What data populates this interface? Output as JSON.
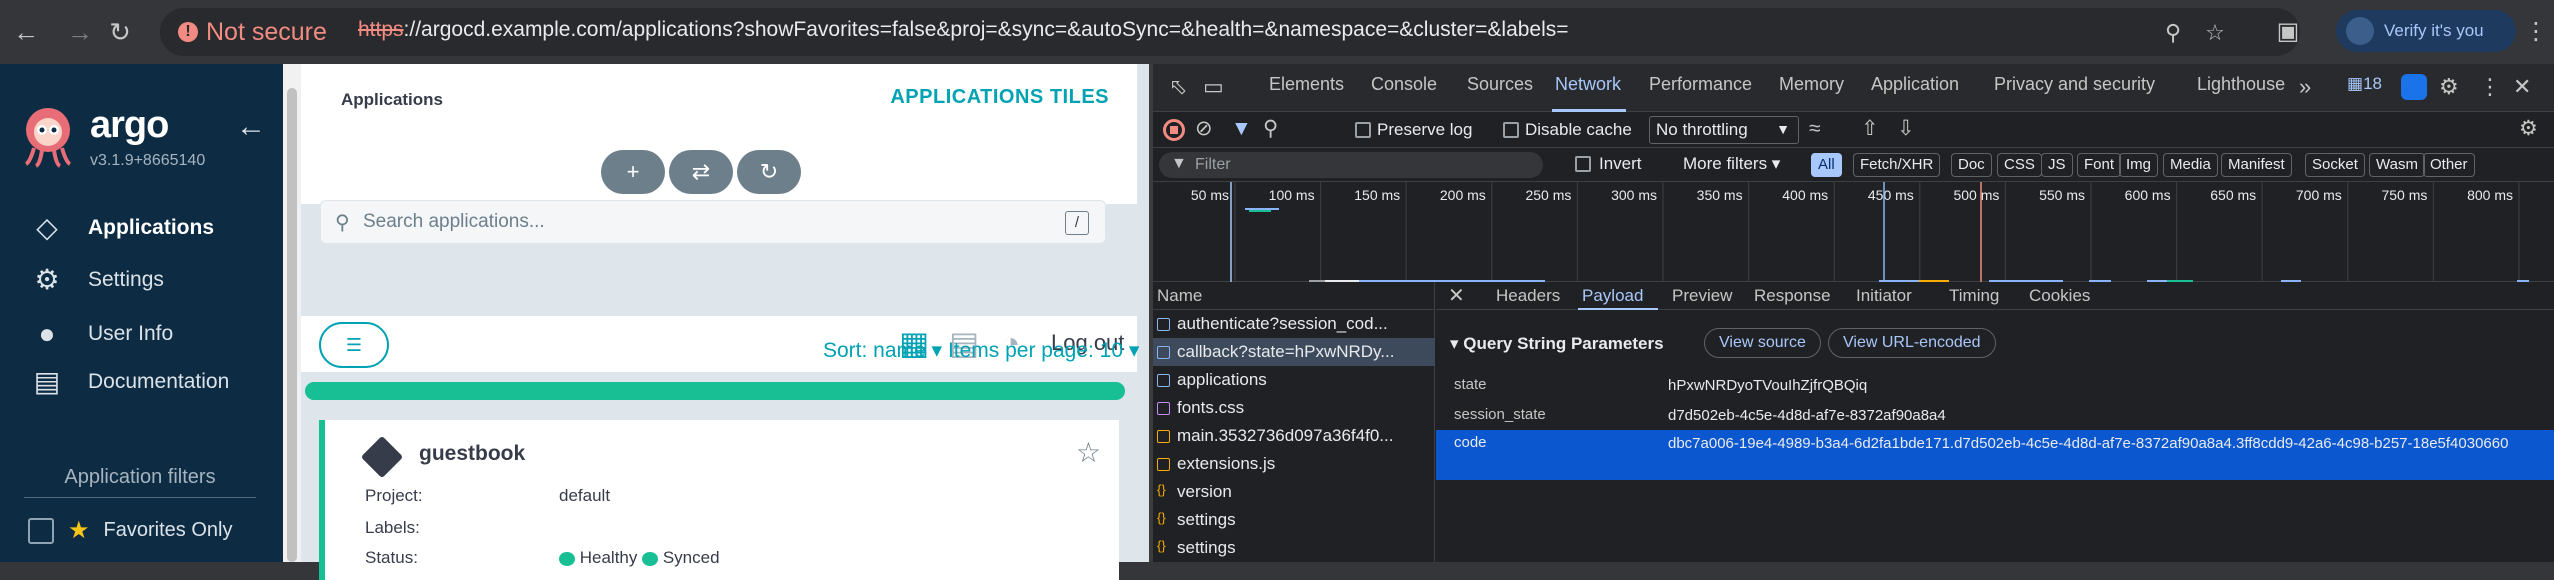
{
  "browser": {
    "not_secure": "Not secure",
    "url_scheme": "https",
    "url_rest": "://argocd.example.com/applications?showFavorites=false&proj=&sync=&autoSync=&health=&namespace=&cluster=&labels=",
    "verify_label": "Verify it's you"
  },
  "sidebar": {
    "brand": "argo",
    "version": "v3.1.9+8665140",
    "items": [
      {
        "label": "Applications",
        "icon": "layers-icon",
        "active": true
      },
      {
        "label": "Settings",
        "icon": "gear-icon"
      },
      {
        "label": "User Info",
        "icon": "user-icon"
      },
      {
        "label": "Documentation",
        "icon": "book-icon"
      }
    ],
    "filters_title": "Application filters",
    "favorites_label": "Favorites Only"
  },
  "main": {
    "breadcrumb": "Applications",
    "view_title": "APPLICATIONS TILES",
    "search_placeholder": "Search applications...",
    "search_shortcut": "/",
    "logout": "Log out",
    "sort_label": "Sort: name ▾",
    "items_per_page": "Items per page: 10 ▾",
    "progress": 1.0,
    "card": {
      "name": "guestbook",
      "project_key": "Project:",
      "project_val": "default",
      "labels_key": "Labels:",
      "status_key": "Status:",
      "health": "Healthy",
      "sync": "Synced"
    }
  },
  "devtools": {
    "tabs": [
      "Elements",
      "Console",
      "Sources",
      "Network",
      "Performance",
      "Memory",
      "Application",
      "Privacy and security",
      "Lighthouse"
    ],
    "active_tab": "Network",
    "issues_count": "18",
    "preserve_log": "Preserve log",
    "disable_cache": "Disable cache",
    "throttling": "No throttling",
    "filter_placeholder": "Filter",
    "invert": "Invert",
    "more_filters": "More filters ▾",
    "type_filters": [
      "All",
      "Fetch/XHR",
      "Doc",
      "CSS",
      "JS",
      "Font",
      "Img",
      "Media",
      "Manifest",
      "Socket",
      "Wasm",
      "Other"
    ],
    "timeline_ticks": [
      "50 ms",
      "100 ms",
      "150 ms",
      "200 ms",
      "250 ms",
      "300 ms",
      "350 ms",
      "400 ms",
      "450 ms",
      "500 ms",
      "550 ms",
      "600 ms",
      "650 ms",
      "700 ms",
      "750 ms",
      "800 ms"
    ],
    "name_header": "Name",
    "requests": [
      {
        "name": "authenticate?session_cod...",
        "kind": "doc"
      },
      {
        "name": "callback?state=hPxwNRDy...",
        "kind": "doc",
        "selected": true
      },
      {
        "name": "applications",
        "kind": "doc"
      },
      {
        "name": "fonts.css",
        "kind": "css"
      },
      {
        "name": "main.3532736d097a36f4f0...",
        "kind": "js"
      },
      {
        "name": "extensions.js",
        "kind": "js"
      },
      {
        "name": "version",
        "kind": "xhr"
      },
      {
        "name": "settings",
        "kind": "xhr"
      },
      {
        "name": "settings",
        "kind": "xhr"
      }
    ],
    "detail_tabs": [
      "Headers",
      "Payload",
      "Preview",
      "Response",
      "Initiator",
      "Timing",
      "Cookies"
    ],
    "active_detail_tab": "Payload",
    "qsp_title": "▾ Query String Parameters",
    "view_source": "View source",
    "view_url_encoded": "View URL-encoded",
    "params": [
      {
        "key": "state",
        "value": "hPxwNRDyoTVouIhZjfrQBQiq"
      },
      {
        "key": "session_state",
        "value": "d7d502eb-4c5e-4d8d-af7e-8372af90a8a4"
      },
      {
        "key": "code",
        "value": "dbc7a006-19e4-4989-b3a4-6d2fa1bde171.d7d502eb-4c5e-4d8d-af7e-8372af90a8a4.3ff8cdd9-42a6-4c98-b257-18e5f4030660",
        "selected": true
      }
    ]
  }
}
